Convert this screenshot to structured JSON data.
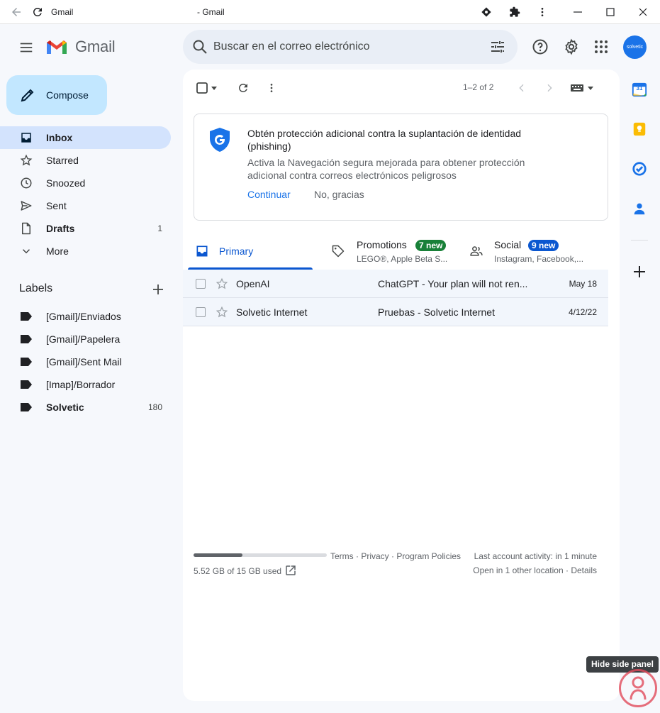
{
  "window": {
    "tab_title": "Gmail",
    "window_title": "- Gmail"
  },
  "header": {
    "logo_text": "Gmail",
    "search_placeholder": "Buscar en el correo electrónico",
    "avatar_text": "solvetic"
  },
  "compose": {
    "label": "Compose"
  },
  "nav": [
    {
      "label": "Inbox",
      "icon": "inbox-icon",
      "active": true,
      "bold": true,
      "count": ""
    },
    {
      "label": "Starred",
      "icon": "star-icon",
      "count": ""
    },
    {
      "label": "Snoozed",
      "icon": "clock-icon",
      "count": ""
    },
    {
      "label": "Sent",
      "icon": "send-icon",
      "count": ""
    },
    {
      "label": "Drafts",
      "icon": "draft-icon",
      "bold": true,
      "count": "1"
    },
    {
      "label": "More",
      "icon": "chevron-down-icon",
      "count": ""
    }
  ],
  "labels": {
    "header": "Labels",
    "items": [
      {
        "label": "[Gmail]/Enviados",
        "count": ""
      },
      {
        "label": "[Gmail]/Papelera",
        "count": ""
      },
      {
        "label": "[Gmail]/Sent Mail",
        "count": ""
      },
      {
        "label": "[Imap]/Borrador",
        "count": ""
      },
      {
        "label": "Solvetic",
        "count": "180",
        "bold": true
      }
    ]
  },
  "toolbar": {
    "paging": "1–2 of 2"
  },
  "promo": {
    "title": "Obtén protección adicional contra la suplantación de identidad (phishing)",
    "body": "Activa la Navegación segura mejorada para obtener protección adicional contra correos electrónicos peligrosos",
    "continue_label": "Continuar",
    "dismiss_label": "No, gracias"
  },
  "tabs": {
    "primary": {
      "label": "Primary"
    },
    "promotions": {
      "label": "Promotions",
      "badge": "7 new",
      "sub": "LEGO®, Apple Beta S..."
    },
    "social": {
      "label": "Social",
      "badge": "9 new",
      "sub": "Instagram, Facebook,..."
    }
  },
  "emails": [
    {
      "sender": "OpenAI",
      "subject": "ChatGPT - Your plan will not ren...",
      "date": "May 18"
    },
    {
      "sender": "Solvetic Internet",
      "subject": "Pruebas - Solvetic Internet",
      "date": "4/12/22"
    }
  ],
  "footer": {
    "storage_text": "5.52 GB of 15 GB used",
    "storage_fraction": 0.368,
    "policy_links": "Terms · Privacy · Program Policies",
    "activity": "Last account activity: in 1 minute",
    "location": "Open in 1 other location · Details"
  },
  "side_panel": {
    "tooltip": "Hide side panel",
    "calendar_day": "31"
  },
  "colors": {
    "accent": "#0b57d0",
    "compose_bg": "#c2e7ff",
    "active_nav": "#d3e3fd",
    "badge_green": "#188038",
    "badge_blue": "#0b57d0"
  }
}
